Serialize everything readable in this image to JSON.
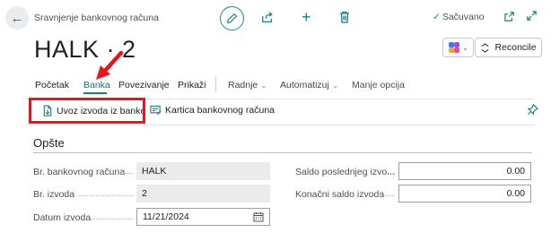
{
  "header": {
    "breadcrumb": "Sravnjenje bankovnog računa",
    "saved_status": "Sačuvano",
    "title": "HALK · 2"
  },
  "actions": {
    "reconcile_label": "Reconcile"
  },
  "menu": {
    "items": [
      {
        "label": "Početak"
      },
      {
        "label": "Banka",
        "active": true
      },
      {
        "label": "Povezivanje"
      },
      {
        "label": "Prikaži"
      }
    ],
    "dropdowns": [
      {
        "label": "Radnje"
      },
      {
        "label": "Automatizuj"
      }
    ],
    "more_label": "Manje opcija"
  },
  "subactions": {
    "import_label": "Uvoz izvoda iz banke",
    "card_label": "Kartica bankovnog računa"
  },
  "section": {
    "title": "Opšte",
    "left_fields": [
      {
        "label": "Br. bankovnog računa",
        "value": "HALK"
      },
      {
        "label": "Br. izvoda",
        "value": "2"
      },
      {
        "label": "Datum izvoda",
        "value": "11/21/2024"
      }
    ],
    "right_fields": [
      {
        "label": "Saldo poslednjeg izvo...",
        "value": "0.00"
      },
      {
        "label": "Konačni saldo izvoda",
        "value": "0.00"
      }
    ]
  },
  "colors": {
    "accent": "#1a7f7f",
    "highlight": "#e8141b"
  }
}
